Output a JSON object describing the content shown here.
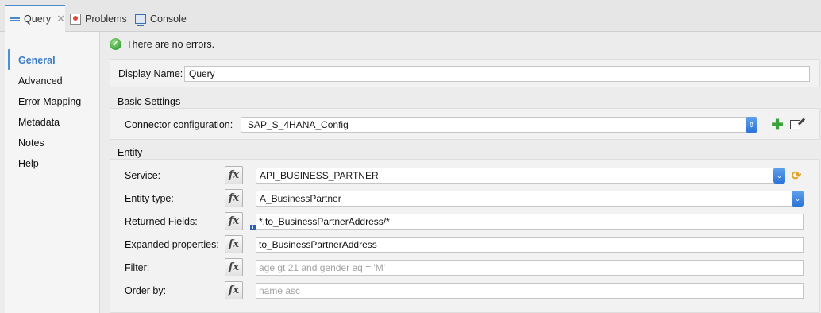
{
  "tabs": [
    {
      "label": "Query",
      "active": true,
      "icon": "mule-component-icon"
    },
    {
      "label": "Problems",
      "active": false,
      "icon": "problems-icon"
    },
    {
      "label": "Console",
      "active": false,
      "icon": "console-icon"
    }
  ],
  "nav": {
    "items": [
      "General",
      "Advanced",
      "Error Mapping",
      "Metadata",
      "Notes",
      "Help"
    ],
    "active": "General"
  },
  "status": {
    "text": "There are no errors.",
    "icon": "check-circle-icon"
  },
  "display_name": {
    "label": "Display Name:",
    "value": "Query"
  },
  "basic_settings": {
    "title": "Basic Settings",
    "connector_label": "Connector configuration:",
    "connector_value": "SAP_S_4HANA_Config"
  },
  "entity": {
    "title": "Entity",
    "service": {
      "label": "Service:",
      "value": "API_BUSINESS_PARTNER"
    },
    "entity_type": {
      "label": "Entity type:",
      "value": "A_BusinessPartner"
    },
    "returned_fields": {
      "label": "Returned Fields:",
      "value": "*,to_BusinessPartnerAddress/*"
    },
    "expanded_properties": {
      "label": "Expanded properties:",
      "value": "to_BusinessPartnerAddress"
    },
    "filter": {
      "label": "Filter:",
      "value": "",
      "placeholder": "age gt 21 and gender eq = 'M'"
    },
    "order_by": {
      "label": "Order by:",
      "value": "",
      "placeholder": "name asc"
    }
  },
  "fx_label": "fx",
  "colors": {
    "accent": "#4a90d4",
    "nav_active": "#3a7cc7",
    "success": "#3aa33b",
    "select_button": "#2a74d8"
  }
}
